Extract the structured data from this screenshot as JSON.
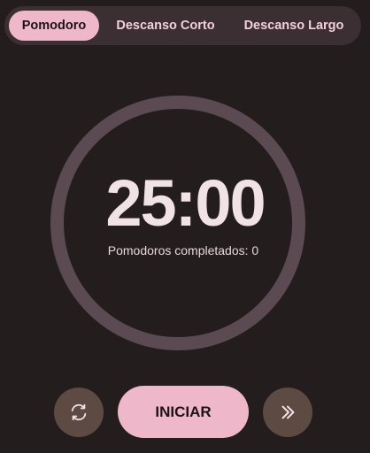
{
  "tabs": [
    {
      "label": "Pomodoro",
      "active": true
    },
    {
      "label": "Descanso Corto",
      "active": false
    },
    {
      "label": "Descanso Largo",
      "active": false
    }
  ],
  "timer": {
    "display": "25:00",
    "completed_label": "Pomodoros completados:",
    "completed_count": "0"
  },
  "controls": {
    "reset_icon": "refresh-icon",
    "start_label": "INICIAR",
    "skip_icon": "double-chevron-right-icon"
  },
  "colors": {
    "background": "#231d1d",
    "accent": "#efb8ca",
    "ring": "#5b4a51",
    "secondary_button": "#5c4a43"
  }
}
